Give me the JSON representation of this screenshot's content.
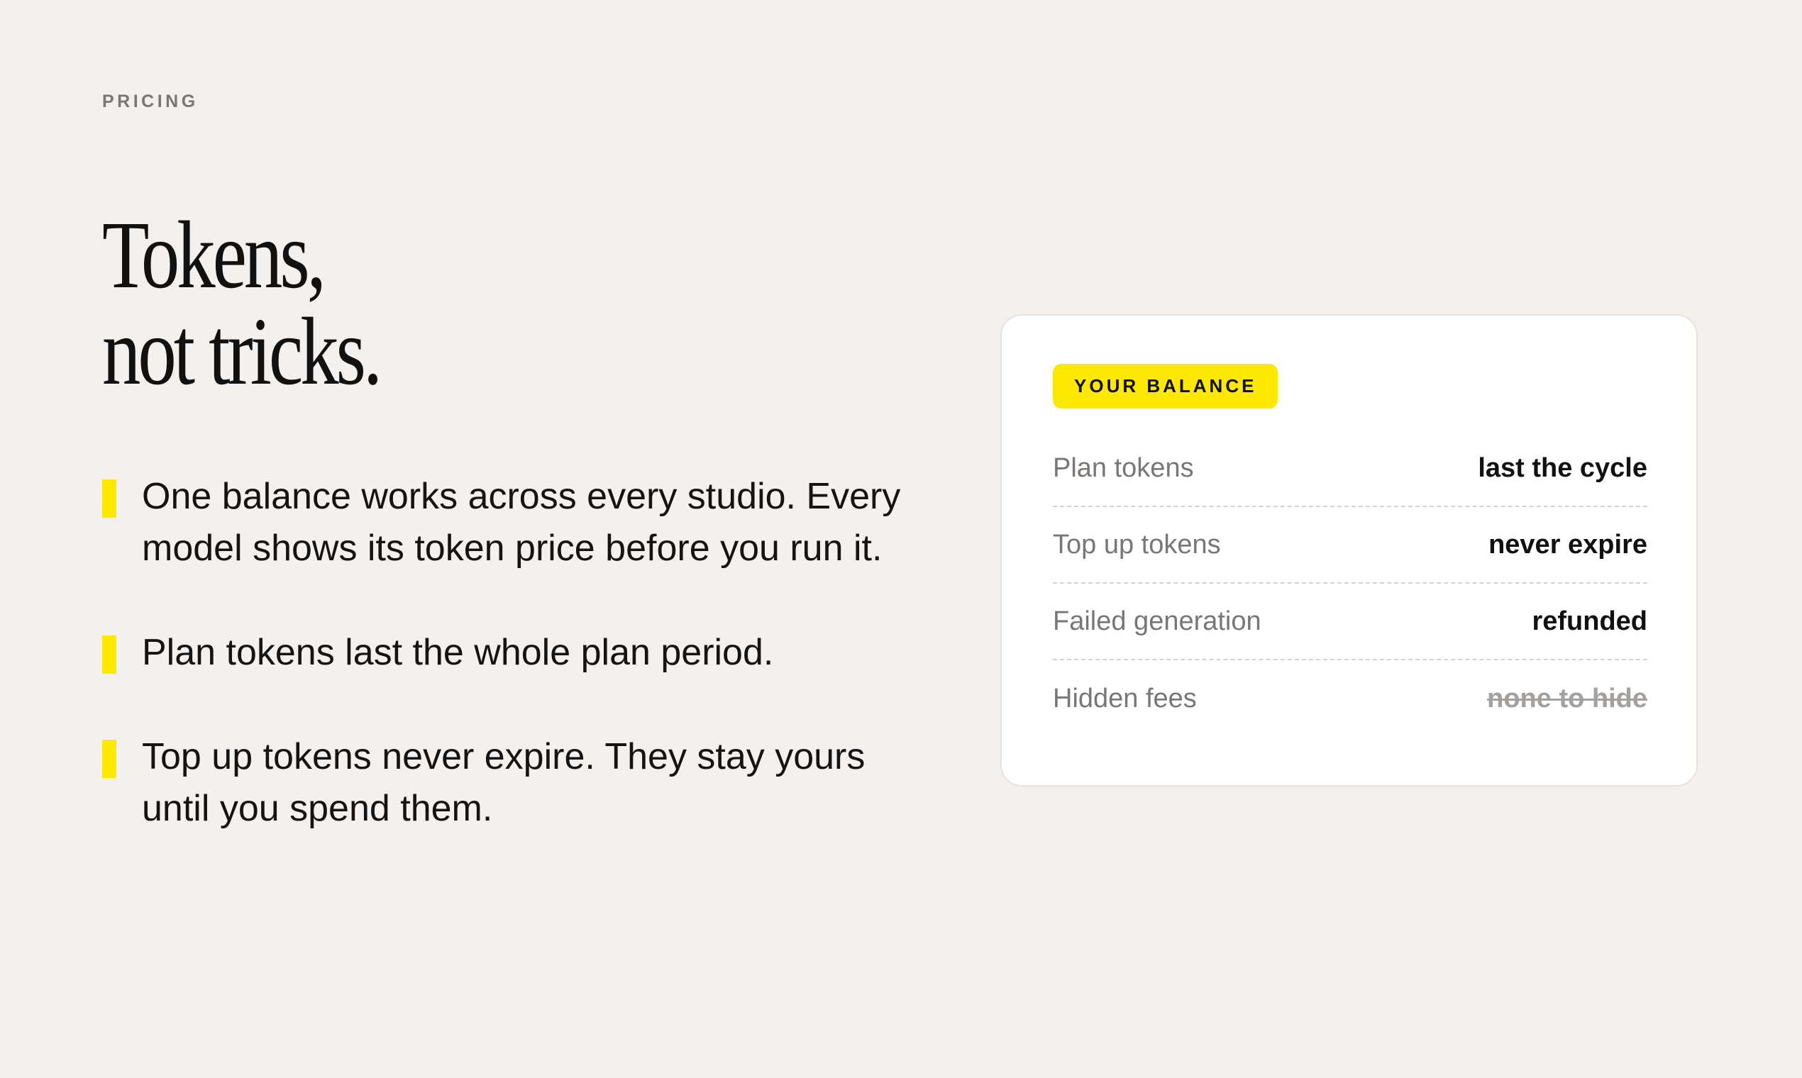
{
  "eyebrow": "PRICING",
  "headline": {
    "line1": "Tokens,",
    "line2": "not tricks."
  },
  "bullets": [
    {
      "text": "One balance works across every studio. Every model shows its token price before you run it."
    },
    {
      "text": "Plan tokens last the whole plan period."
    },
    {
      "text": "Top up tokens never expire. They stay yours until you spend them."
    }
  ],
  "balance_card": {
    "badge": "YOUR BALANCE",
    "rows": [
      {
        "label": "Plan tokens",
        "value": "last the cycle"
      },
      {
        "label": "Top up tokens",
        "value": "never expire"
      },
      {
        "label": "Failed generation",
        "value": "refunded"
      },
      {
        "label": "Hidden fees",
        "value": "none to hide"
      }
    ]
  },
  "colors": {
    "background": "#f3f0ee",
    "accent_yellow": "#fce800",
    "text": "#111111",
    "muted_text": "#7a7673",
    "card": "#ffffff"
  }
}
